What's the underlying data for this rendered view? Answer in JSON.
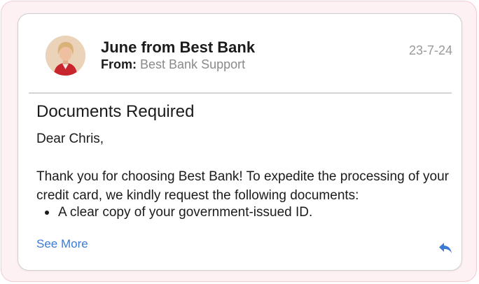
{
  "email": {
    "sender_name": "June from Best Bank",
    "from_label": "From:",
    "from_value": "Best Bank Support",
    "date": "23-7-24",
    "subject": "Documents Required",
    "greeting": "Dear Chris,",
    "body": "Thank you for choosing Best Bank! To expedite the processing of your credit card, we kindly request the following documents:",
    "bullets": [
      "A clear copy of your government-issued ID."
    ],
    "see_more_label": "See More",
    "reply_icon": "reply-icon",
    "avatar_icon": "avatar"
  },
  "colors": {
    "link": "#3b7bd4",
    "date": "#9a9a9a",
    "frame_border": "#f4cbd3",
    "card_border": "#cfcfcf"
  }
}
